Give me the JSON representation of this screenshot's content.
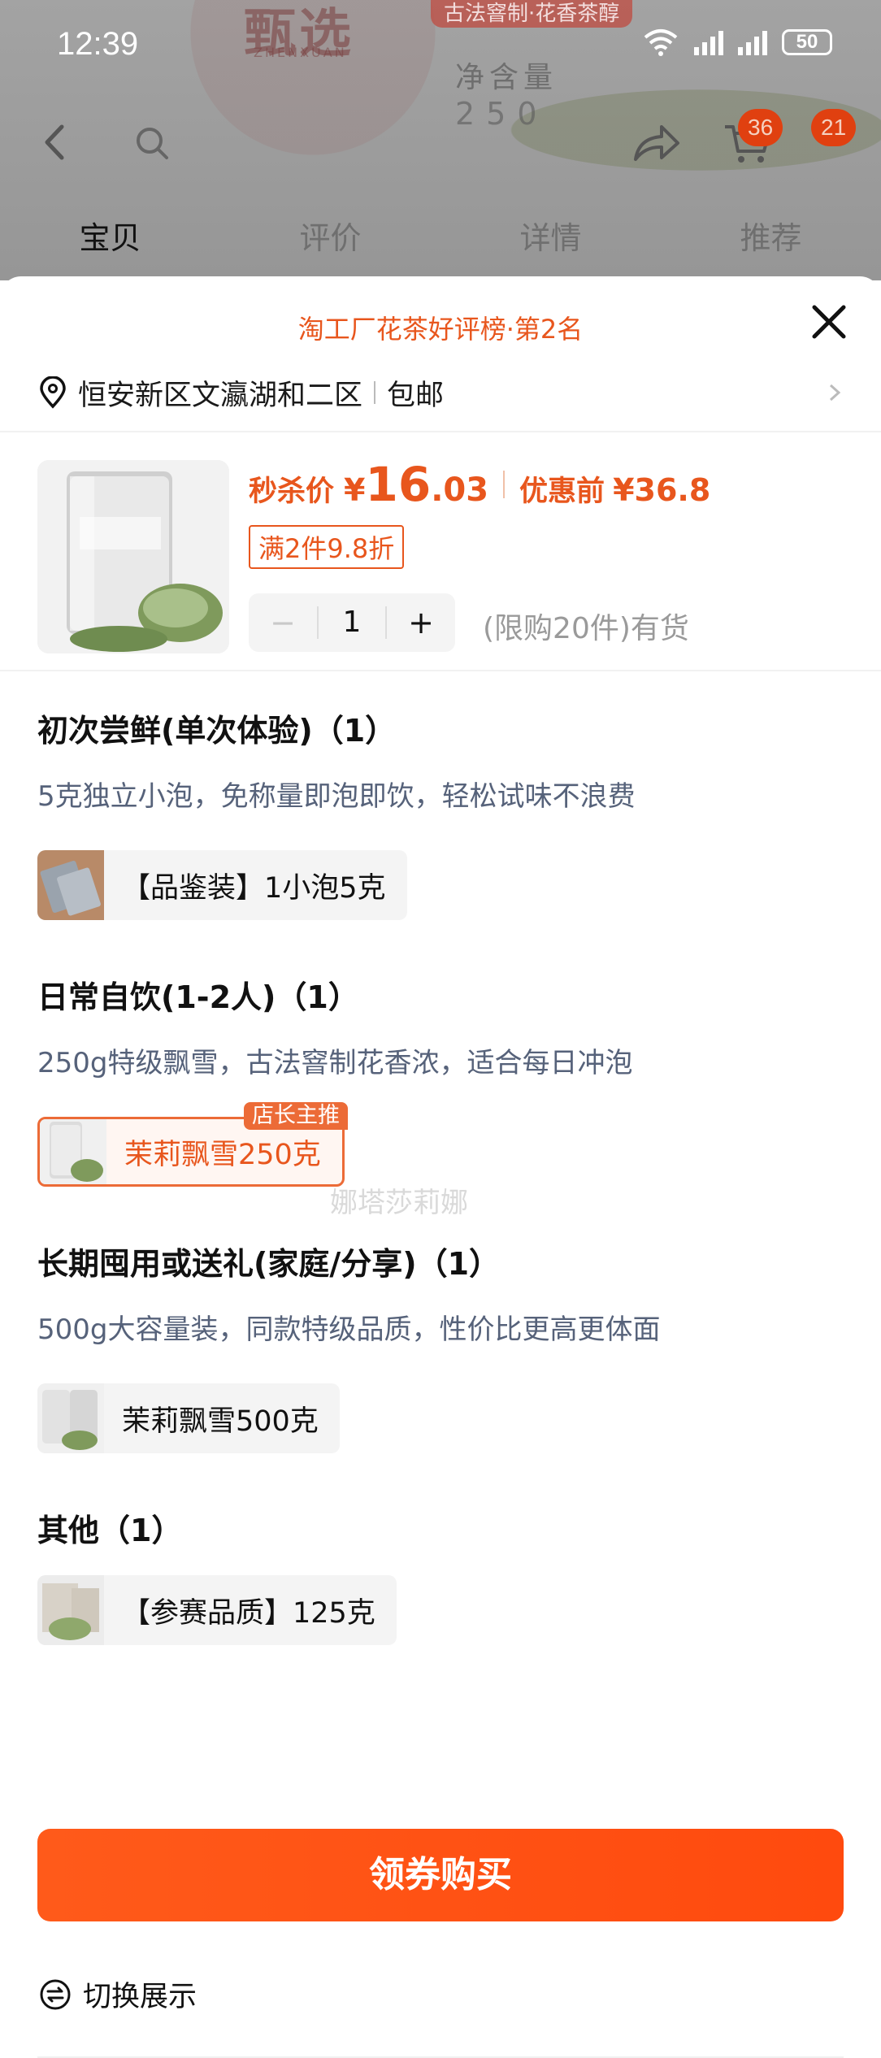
{
  "status_bar": {
    "time": "12:39",
    "battery": "50",
    "network": "6"
  },
  "background": {
    "brand_logo": "甄选",
    "brand_logo_sub": "ZHENXUAN",
    "banner": "古法窨制·花香茶醇",
    "net_weight": "净含量",
    "net_weight_value": "250",
    "cart_count": "36",
    "message_count": "21",
    "tabs": [
      "宝贝",
      "评价",
      "详情",
      "推荐"
    ]
  },
  "sheet": {
    "rank": "淘工厂花茶好评榜·第2名",
    "address": "恒安新区文瀛湖和二区",
    "shipping": "包邮",
    "price": {
      "label": "秒杀价",
      "currency": "¥",
      "integer": "16",
      "decimal": ".03",
      "before_label": "优惠前",
      "before_value": "¥36.8"
    },
    "promo": "满2件9.8折",
    "quantity": "1",
    "minus": "−",
    "plus": "+",
    "stock": "(限购20件)有货",
    "sections": [
      {
        "title": "初次尝鲜(单次体验)（1）",
        "desc": "5克独立小泡，免称量即泡即饮，轻松试味不浪费",
        "option": "【品鉴装】1小泡5克"
      },
      {
        "title": "日常自饮(1-2人)（1）",
        "desc": "250g特级飘雪，古法窨制花香浓，适合每日冲泡",
        "option": "茉莉飘雪250克",
        "tag": "店长主推"
      },
      {
        "title": "长期囤用或送礼(家庭/分享)（1）",
        "desc": "500g大容量装，同款特级品质，性价比更高更体面",
        "option": "茉莉飘雪500克"
      },
      {
        "title": "其他（1）",
        "option": "【参赛品质】125克"
      }
    ],
    "watermark": "娜塔莎莉娜",
    "switch_label": "切换展示",
    "buy_button": "领券购买"
  },
  "colors": {
    "accent": "#e8561d",
    "button": "#ff5a1a",
    "desc": "#56627a"
  },
  "icons": [
    "back-icon",
    "search-icon",
    "share-icon",
    "cart-icon",
    "close-icon",
    "location-pin-icon",
    "chevron-right-icon",
    "switch-icon"
  ]
}
